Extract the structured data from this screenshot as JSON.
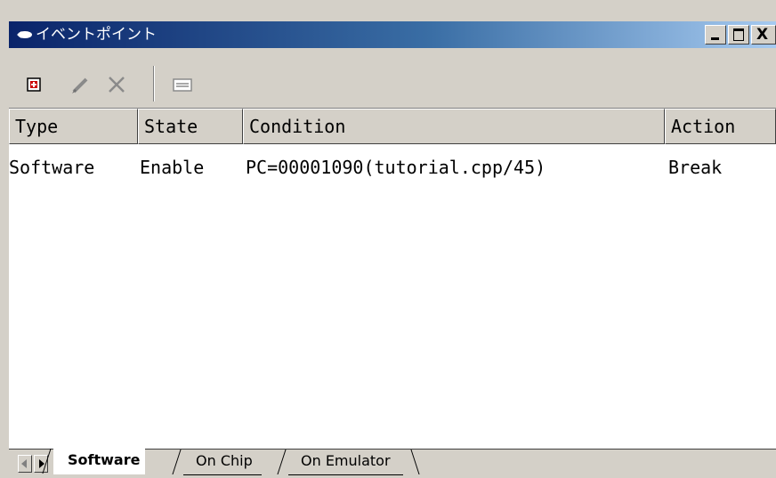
{
  "window": {
    "title": "イベントポイント",
    "close_glyph": "X"
  },
  "toolbar": {
    "icons": [
      "add-icon",
      "edit-icon",
      "delete-icon",
      "properties-icon"
    ]
  },
  "list": {
    "columns": [
      "Type",
      "State",
      "Condition",
      "Action"
    ],
    "rows": [
      {
        "type": "Software",
        "state": "Enable",
        "condition": "PC=00001090(tutorial.cpp/45)",
        "action": "Break"
      }
    ]
  },
  "tabs": {
    "items": [
      "Software",
      "On Chip",
      "On Emulator"
    ],
    "selected": "Software"
  },
  "colors": {
    "title_start": "#0a246a",
    "title_end": "#a6caf0",
    "chrome": "#d4d0c8"
  }
}
